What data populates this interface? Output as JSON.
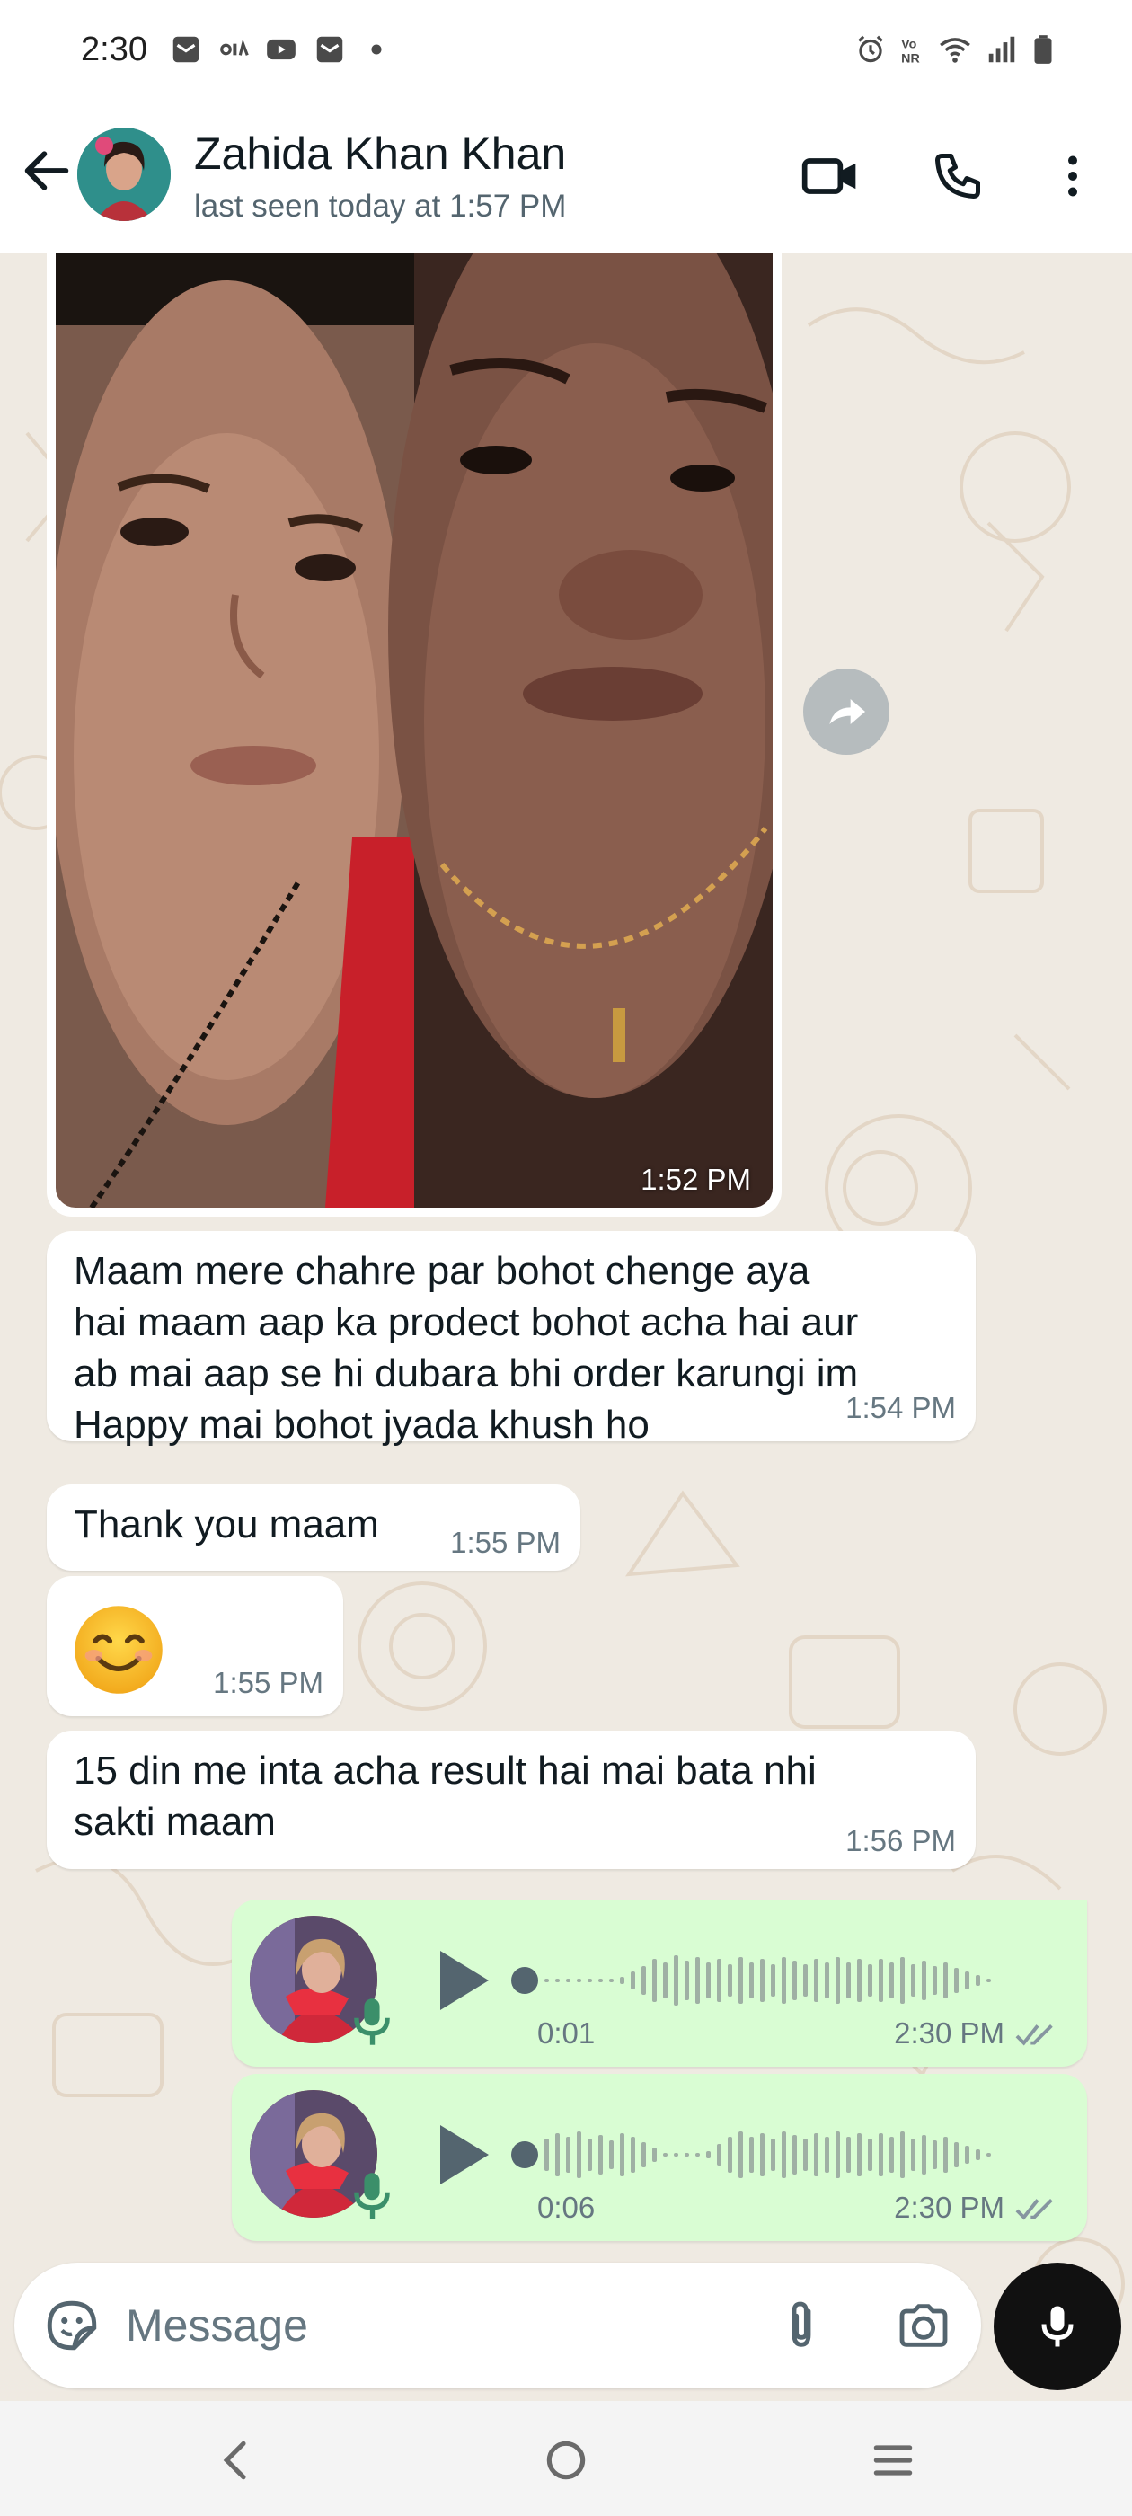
{
  "status_bar": {
    "time": "2:30",
    "left_icons": [
      "mail-icon",
      "ola-icon",
      "youtube-icon",
      "mail-icon",
      "dot-icon"
    ],
    "right_icons": [
      "alarm-icon",
      "vonr-icon",
      "wifi-icon",
      "signal-icon",
      "battery-icon"
    ]
  },
  "header": {
    "contact_name": "Zahida Khan Khan",
    "last_seen": "last seen today at 1:57 PM"
  },
  "messages": [
    {
      "type": "image",
      "direction": "incoming",
      "time": "1:52 PM"
    },
    {
      "type": "text",
      "direction": "incoming",
      "text_lines": [
        "Maam mere chahre par bohot chenge aya",
        "hai maam aap ka prodect bohot acha hai aur",
        "ab mai aap se hi dubara bhi order karungi im",
        "Happy mai bohot jyada khush ho"
      ],
      "time": "1:54 PM"
    },
    {
      "type": "text",
      "direction": "incoming",
      "text": "Thank you maam",
      "time": "1:55 PM"
    },
    {
      "type": "emoji",
      "direction": "incoming",
      "emoji": "smiling-face-icon",
      "time": "1:55 PM"
    },
    {
      "type": "text",
      "direction": "incoming",
      "text_lines": [
        "15 din me inta acha result hai mai bata nhi",
        "sakti maam"
      ],
      "time": "1:56 PM"
    },
    {
      "type": "voice",
      "direction": "outgoing",
      "duration": "0:01",
      "time": "2:30 PM",
      "status": "read"
    },
    {
      "type": "voice",
      "direction": "outgoing",
      "duration": "0:06",
      "time": "2:30 PM",
      "status": "read"
    }
  ],
  "input": {
    "placeholder": "Message"
  },
  "colors": {
    "chat_background": "#efeae2",
    "incoming_bubble": "#ffffff",
    "outgoing_bubble": "#d9fdd3",
    "read_ticks": "#8696a0",
    "mic_button": "#111111"
  }
}
